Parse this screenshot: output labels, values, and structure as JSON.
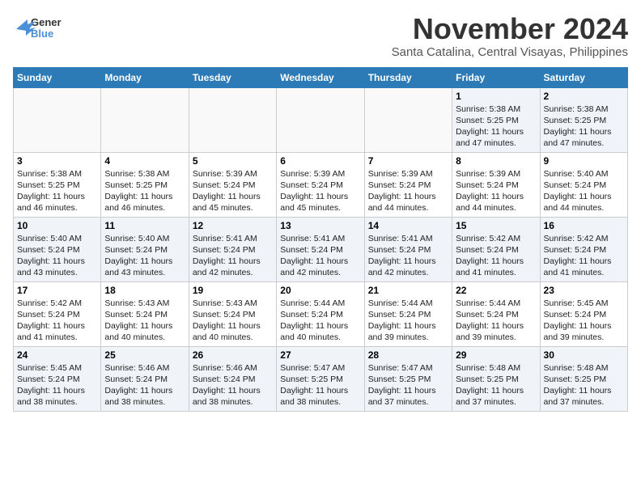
{
  "logo": {
    "line1": "General",
    "line2": "Blue"
  },
  "title": "November 2024",
  "location": "Santa Catalina, Central Visayas, Philippines",
  "weekdays": [
    "Sunday",
    "Monday",
    "Tuesday",
    "Wednesday",
    "Thursday",
    "Friday",
    "Saturday"
  ],
  "weeks": [
    [
      {
        "day": "",
        "info": ""
      },
      {
        "day": "",
        "info": ""
      },
      {
        "day": "",
        "info": ""
      },
      {
        "day": "",
        "info": ""
      },
      {
        "day": "",
        "info": ""
      },
      {
        "day": "1",
        "info": "Sunrise: 5:38 AM\nSunset: 5:25 PM\nDaylight: 11 hours and 47 minutes."
      },
      {
        "day": "2",
        "info": "Sunrise: 5:38 AM\nSunset: 5:25 PM\nDaylight: 11 hours and 47 minutes."
      }
    ],
    [
      {
        "day": "3",
        "info": "Sunrise: 5:38 AM\nSunset: 5:25 PM\nDaylight: 11 hours and 46 minutes."
      },
      {
        "day": "4",
        "info": "Sunrise: 5:38 AM\nSunset: 5:25 PM\nDaylight: 11 hours and 46 minutes."
      },
      {
        "day": "5",
        "info": "Sunrise: 5:39 AM\nSunset: 5:24 PM\nDaylight: 11 hours and 45 minutes."
      },
      {
        "day": "6",
        "info": "Sunrise: 5:39 AM\nSunset: 5:24 PM\nDaylight: 11 hours and 45 minutes."
      },
      {
        "day": "7",
        "info": "Sunrise: 5:39 AM\nSunset: 5:24 PM\nDaylight: 11 hours and 44 minutes."
      },
      {
        "day": "8",
        "info": "Sunrise: 5:39 AM\nSunset: 5:24 PM\nDaylight: 11 hours and 44 minutes."
      },
      {
        "day": "9",
        "info": "Sunrise: 5:40 AM\nSunset: 5:24 PM\nDaylight: 11 hours and 44 minutes."
      }
    ],
    [
      {
        "day": "10",
        "info": "Sunrise: 5:40 AM\nSunset: 5:24 PM\nDaylight: 11 hours and 43 minutes."
      },
      {
        "day": "11",
        "info": "Sunrise: 5:40 AM\nSunset: 5:24 PM\nDaylight: 11 hours and 43 minutes."
      },
      {
        "day": "12",
        "info": "Sunrise: 5:41 AM\nSunset: 5:24 PM\nDaylight: 11 hours and 42 minutes."
      },
      {
        "day": "13",
        "info": "Sunrise: 5:41 AM\nSunset: 5:24 PM\nDaylight: 11 hours and 42 minutes."
      },
      {
        "day": "14",
        "info": "Sunrise: 5:41 AM\nSunset: 5:24 PM\nDaylight: 11 hours and 42 minutes."
      },
      {
        "day": "15",
        "info": "Sunrise: 5:42 AM\nSunset: 5:24 PM\nDaylight: 11 hours and 41 minutes."
      },
      {
        "day": "16",
        "info": "Sunrise: 5:42 AM\nSunset: 5:24 PM\nDaylight: 11 hours and 41 minutes."
      }
    ],
    [
      {
        "day": "17",
        "info": "Sunrise: 5:42 AM\nSunset: 5:24 PM\nDaylight: 11 hours and 41 minutes."
      },
      {
        "day": "18",
        "info": "Sunrise: 5:43 AM\nSunset: 5:24 PM\nDaylight: 11 hours and 40 minutes."
      },
      {
        "day": "19",
        "info": "Sunrise: 5:43 AM\nSunset: 5:24 PM\nDaylight: 11 hours and 40 minutes."
      },
      {
        "day": "20",
        "info": "Sunrise: 5:44 AM\nSunset: 5:24 PM\nDaylight: 11 hours and 40 minutes."
      },
      {
        "day": "21",
        "info": "Sunrise: 5:44 AM\nSunset: 5:24 PM\nDaylight: 11 hours and 39 minutes."
      },
      {
        "day": "22",
        "info": "Sunrise: 5:44 AM\nSunset: 5:24 PM\nDaylight: 11 hours and 39 minutes."
      },
      {
        "day": "23",
        "info": "Sunrise: 5:45 AM\nSunset: 5:24 PM\nDaylight: 11 hours and 39 minutes."
      }
    ],
    [
      {
        "day": "24",
        "info": "Sunrise: 5:45 AM\nSunset: 5:24 PM\nDaylight: 11 hours and 38 minutes."
      },
      {
        "day": "25",
        "info": "Sunrise: 5:46 AM\nSunset: 5:24 PM\nDaylight: 11 hours and 38 minutes."
      },
      {
        "day": "26",
        "info": "Sunrise: 5:46 AM\nSunset: 5:24 PM\nDaylight: 11 hours and 38 minutes."
      },
      {
        "day": "27",
        "info": "Sunrise: 5:47 AM\nSunset: 5:25 PM\nDaylight: 11 hours and 38 minutes."
      },
      {
        "day": "28",
        "info": "Sunrise: 5:47 AM\nSunset: 5:25 PM\nDaylight: 11 hours and 37 minutes."
      },
      {
        "day": "29",
        "info": "Sunrise: 5:48 AM\nSunset: 5:25 PM\nDaylight: 11 hours and 37 minutes."
      },
      {
        "day": "30",
        "info": "Sunrise: 5:48 AM\nSunset: 5:25 PM\nDaylight: 11 hours and 37 minutes."
      }
    ]
  ]
}
